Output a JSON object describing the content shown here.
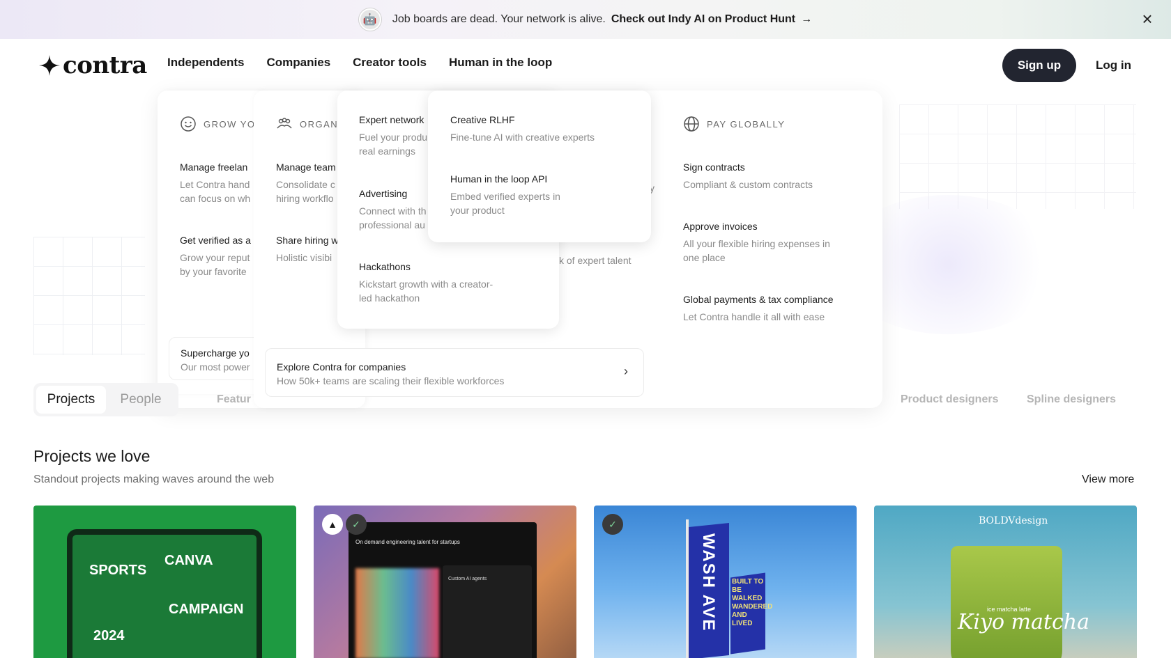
{
  "announcement": {
    "message": "Job boards are dead. Your network is alive.",
    "cta": "Check out Indy AI on Product Hunt",
    "cta_icon": "arrow-right-icon",
    "close_icon": "close-icon"
  },
  "header": {
    "logo_text": "contra",
    "nav": [
      "Independents",
      "Companies",
      "Creator tools",
      "Human in the loop"
    ],
    "signup": "Sign up",
    "login": "Log in"
  },
  "menu": {
    "col1": {
      "heading": "GROW YOU",
      "items": [
        {
          "title": "Manage freelan",
          "desc1": "Let Contra hand",
          "desc2": "can focus on wh"
        },
        {
          "title": "Get verified as a",
          "desc1": "Grow your reput",
          "desc2": "by your favorite"
        }
      ],
      "footer_title": "Supercharge yo",
      "footer_desc": "Our most power"
    },
    "col2": {
      "heading": "ORGANI",
      "items": [
        {
          "title": "Manage team",
          "desc1": "Consolidate c",
          "desc2": "hiring workflo"
        },
        {
          "title": "Share hiring w",
          "desc1": "Holistic visibi",
          "desc2": ""
        }
      ]
    },
    "col3": {
      "items": [
        {
          "title": "Expert network",
          "desc1": "Fuel your produ",
          "desc2": "real earnings"
        },
        {
          "title": "Advertising",
          "desc1": "Connect with th",
          "desc2": "professional au"
        },
        {
          "title": "Hackathons",
          "desc1": "Kickstart growth with a creator-",
          "desc2": "led hackathon"
        }
      ]
    },
    "col4": {
      "items": [
        {
          "title": "Creative RLHF",
          "desc1": "Fine-tune AI with creative experts",
          "desc2": ""
        },
        {
          "title": "Human in the loop API",
          "desc1": "Embed verified experts in",
          "desc2": "your product"
        }
      ]
    },
    "peek": {
      "fragment1": "y",
      "fragment2": "tors",
      "fragment3": "k of expert talent"
    },
    "col5": {
      "heading": "PAY GLOBALLY",
      "items": [
        {
          "title": "Sign contracts",
          "desc1": "Compliant & custom contracts",
          "desc2": ""
        },
        {
          "title": "Approve invoices",
          "desc1": "All your flexible hiring expenses in",
          "desc2": "one place"
        },
        {
          "title": "Global payments & tax compliance",
          "desc1": "Let Contra handle it all with ease",
          "desc2": ""
        }
      ]
    },
    "explore": {
      "title": "Explore Contra for companies",
      "desc": "How 50k+ teams are scaling their flexible workforces"
    }
  },
  "tabs": {
    "items": [
      "Projects",
      "People"
    ],
    "active": "Projects",
    "chips": [
      "Featur",
      "Product designers",
      "Spline designers"
    ]
  },
  "projects": {
    "title": "Projects we love",
    "subtitle": "Standout projects making waves around the web",
    "view_more": "View more",
    "card1": {
      "w1": "CANVA",
      "w2": "SPORTS",
      "w3": "CAMPAIGN",
      "w4": "2024"
    },
    "card2": {
      "headline": "On demand engineering talent for startups",
      "panel_label": "Custom AI agents"
    },
    "card3": {
      "flag": "WASH AVE",
      "flag2": "BUILT TO BE WALKED WANDERED AND LIVED"
    },
    "card4": {
      "brand": "BOLDVdesign",
      "label": "ice matcha latte",
      "script": "Kiyo matcha"
    }
  }
}
